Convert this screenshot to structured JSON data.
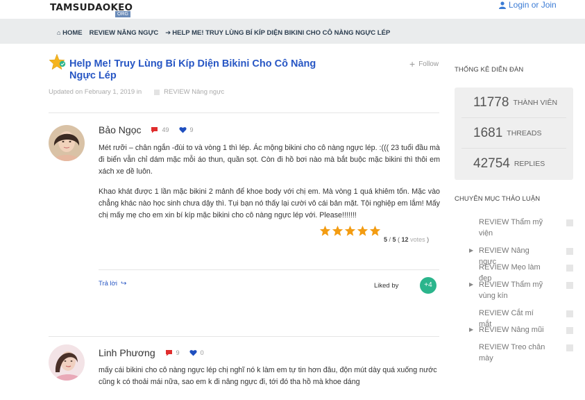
{
  "header": {
    "logo": "TAMSUDAOKEO",
    "logo_sub": "ORG",
    "login": "Login or Join"
  },
  "breadcrumb": {
    "home": "HOME",
    "category": "REVIEW Nâng ngực",
    "current": "HELP ME! TRUY LÙNG BÍ KÍP DIỆN BIKINI CHO CÔ NÀNG NGỰC LÉP"
  },
  "thread": {
    "title": "Help Me! Truy Lùng Bí Kíp Diện Bikini Cho Cô Nàng Ngực Lép",
    "follow": "Follow",
    "updated": "Updated on February 1, 2019 in",
    "category": "REVIEW Nâng ngực"
  },
  "posts": [
    {
      "author": "Bảo Ngọc",
      "comments": "49",
      "likes": "9",
      "paragraphs": [
        "Mét rưỡi – chân ngắn -đùi to và vòng 1 thì lép. Ác mộng bikini cho cô nàng ngực lép. :((( 23 tuổi đầu mà đi biển vẫn chỉ dám mặc mỗi áo thun, quần sọt. Còn đi hồ bơi nào mà bắt buộc mặc bikini thì thôi em xách xe dề luôn.",
        "Khao khát được 1 lần mặc bikini 2 mảnh để khoe body với chị em. Mà vòng 1 quá khiêm tốn. Mặc vào chẳng khác nào học sinh chưa dậy thì. Tụi bạn nó thấy lại cười vô cái bản mặt. Tội nghiệp em lắm! Mấy chị mấy mẹ cho em xin bí kíp mặc bikini cho cô nàng ngực lép với. Please!!!!!!!"
      ],
      "rating_score": "5",
      "rating_max": "5",
      "rating_votes": "12",
      "rating_votes_label": "votes",
      "reply": "Trả lời",
      "liked_by": "Liked by",
      "liked_count": "+4"
    },
    {
      "author": "Linh Phương",
      "comments": "9",
      "likes": "0",
      "paragraphs": [
        "mấy cái bikini cho cô nàng ngực lép chị nghĩ nó k làm em tự tin hơn đâu, độn mút dày quá xuống nước cũng k có thoải mái nữa, sao em k đi nâng ngực đi, tới đó tha hồ mà khoe dáng"
      ]
    }
  ],
  "sidebar": {
    "stats_title": "THỐNG KÊ DIỄN ĐÀN",
    "stats": [
      {
        "value": "11778",
        "label": "THÀNH VIÊN"
      },
      {
        "value": "1681",
        "label": "THREADS"
      },
      {
        "value": "42754",
        "label": "REPLIES"
      }
    ],
    "cats_title": "CHUYÊN MỤC THẢO LUẬN",
    "categories": [
      {
        "label": "REVIEW Thẩm mỹ viện"
      },
      {
        "label": "REVIEW Nâng ngực"
      },
      {
        "label": "REVIEW Mẹo làm đẹp"
      },
      {
        "label": "REVIEW Thẩm mỹ vùng kín"
      },
      {
        "label": "REVIEW Cắt mí mắt"
      },
      {
        "label": "REVIEW Nâng mũi"
      },
      {
        "label": "REVIEW Treo chân mày"
      }
    ]
  },
  "colors": {
    "link": "#2756c4",
    "accent_green": "#2bb58c",
    "star": "#f5a623"
  }
}
